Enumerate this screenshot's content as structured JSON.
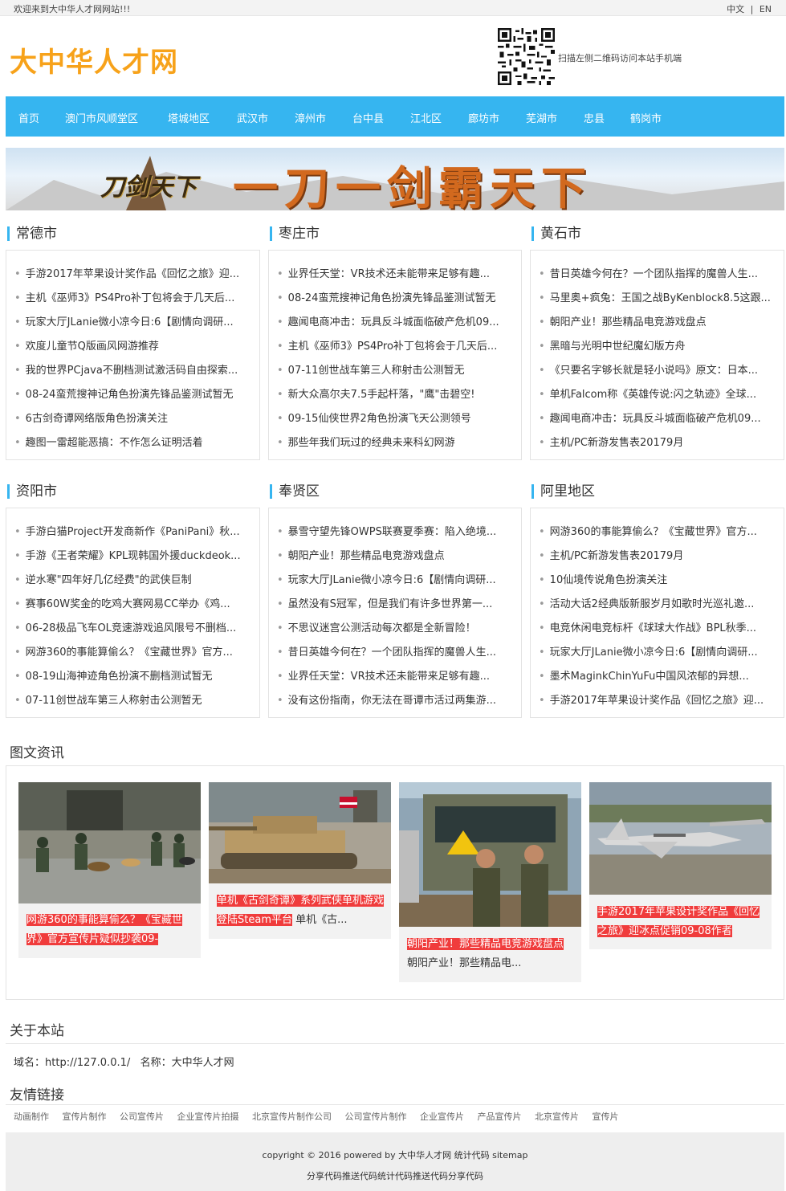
{
  "topbar": {
    "welcome": "欢迎来到大中华人才网网站!!!",
    "lang_cn": "中文",
    "sep": "|",
    "lang_en": "EN"
  },
  "header": {
    "logo": "大中华人才网",
    "qr_text": "扫描左侧二维码访问本站手机端"
  },
  "nav": [
    "首页",
    "澳门市风顺堂区",
    "塔城地区",
    "武汉市",
    "漳州市",
    "台中县",
    "江北区",
    "廊坊市",
    "芜湖市",
    "忠县",
    "鹤岗市"
  ],
  "banner": {
    "text": "一刀一剑霸天下",
    "logo": "刀剑天下"
  },
  "sections": [
    {
      "title": "常德市",
      "items": [
        "手游2017年苹果设计奖作品《回忆之旅》迎...",
        "主机《巫师3》PS4Pro补丁包将会于几天后...",
        "玩家大厅JLanie微小凉今日:6【剧情向调研...",
        "欢度儿童节Q版画风网游推荐",
        "我的世界PCjava不删档测试激活码自由探索...",
        "08-24蛮荒搜神记角色扮演先锋品鉴测试暂无",
        "6古剑奇谭网络版角色扮演关注",
        "趣图一雷超能恶搞：不作怎么证明活着"
      ]
    },
    {
      "title": "枣庄市",
      "items": [
        "业界任天堂：VR技术还未能带来足够有趣...",
        "08-24蛮荒搜神记角色扮演先锋品鉴测试暂无",
        "趣闻电商冲击：玩具反斗城面临破产危机09...",
        "主机《巫师3》PS4Pro补丁包将会于几天后...",
        "07-11创世战车第三人称射击公测暂无",
        "新大众高尔夫7.5手起杆落，\"鹰\"击碧空!",
        "09-15仙侠世界2角色扮演飞天公测领号",
        "那些年我们玩过的经典未来科幻网游"
      ]
    },
    {
      "title": "黄石市",
      "items": [
        "昔日英雄今何在？一个团队指挥的魔兽人生...",
        "马里奥+疯兔：王国之战ByKenblock8.5这跟...",
        "朝阳产业！那些精品电竞游戏盘点",
        "黑暗与光明中世纪魔幻版方舟",
        "《只要名字够长就是轻小说吗》原文：日本...",
        "单机Falcom称《英雄传说:闪之轨迹》全球...",
        "趣闻电商冲击：玩具反斗城面临破产危机09...",
        "主机/PC新游发售表20179月"
      ]
    },
    {
      "title": "资阳市",
      "items": [
        "手游白猫Project开发商新作《PaniPani》秋...",
        "手游《王者荣耀》KPL现韩国外援duckdeok...",
        "逆水寒\"四年好几亿经费\"的武侠巨制",
        "赛事60W奖金的吃鸡大赛网易CC举办《鸡...",
        "06-28极品飞车OL竞速游戏追风限号不删档...",
        "网游360的事能算偷么？《宝藏世界》官方...",
        "08-19山海神迹角色扮演不删档测试暂无",
        "07-11创世战车第三人称射击公测暂无"
      ]
    },
    {
      "title": "奉贤区",
      "items": [
        "暴雪守望先锋OWPS联赛夏季赛：陷入绝境...",
        "朝阳产业！那些精品电竞游戏盘点",
        "玩家大厅JLanie微小凉今日:6【剧情向调研...",
        "虽然没有S冠军，但是我们有许多世界第一...",
        "不思议迷宫公测活动每次都是全新冒险！",
        "昔日英雄今何在？一个团队指挥的魔兽人生...",
        "业界任天堂：VR技术还未能带来足够有趣...",
        "没有这份指南，你无法在哥谭市活过两集游..."
      ]
    },
    {
      "title": "阿里地区",
      "items": [
        "网游360的事能算偷么？《宝藏世界》官方...",
        "主机/PC新游发售表20179月",
        "10仙境传说角色扮演关注",
        "活动大话2经典版新服岁月如歌时光巡礼邀...",
        "电竞休闲电竞标杆《球球大作战》BPL秋季...",
        "玩家大厅JLanie微小凉今日:6【剧情向调研...",
        "墨术MaginkChinYuFu中国风浓郁的异想...",
        "手游2017年苹果设计奖作品《回忆之旅》迎..."
      ]
    }
  ],
  "pictures": {
    "title": "图文资讯",
    "cards": [
      {
        "red": "网游360的事能算偷么？《宝藏世界》官方宣传片疑似抄袭09-",
        "rest": ""
      },
      {
        "red": "单机《古剑奇谭》系列武侠单机游戏登陆Steam平台",
        "rest": "单机《古..."
      },
      {
        "red": "朝阳产业！那些精品电竞游戏盘点",
        "rest": "朝阳产业！那些精品电..."
      },
      {
        "red": "手游2017年苹果设计奖作品《回忆之旅》迎冰点促销09-08作者",
        "rest": ""
      }
    ]
  },
  "about": {
    "title": "关于本站",
    "domain_label": "域名：",
    "domain": "http://127.0.0.1/",
    "name_label": "名称：",
    "name": "大中华人才网"
  },
  "friends": {
    "title": "友情链接",
    "links": [
      "动画制作",
      "宣传片制作",
      "公司宣传片",
      "企业宣传片拍摄",
      "北京宣传片制作公司",
      "公司宣传片制作",
      "企业宣传片",
      "产品宣传片",
      "北京宣传片",
      "宣传片"
    ]
  },
  "footer": {
    "line1": "copyright © 2016 powered by 大中华人才网 统计代码 sitemap",
    "line2": "分享代码推送代码统计代码推送代码分享代码"
  }
}
